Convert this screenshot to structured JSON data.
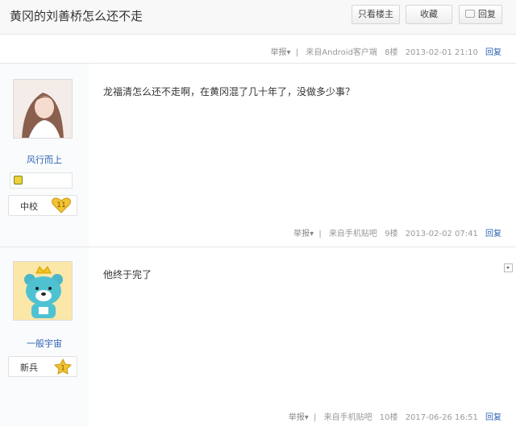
{
  "header": {
    "title": "黄冈的刘善桥怎么还不走",
    "btn_louzhu": "只看楼主",
    "btn_collect": "收藏",
    "btn_reply": "回复"
  },
  "top_tail": {
    "report": "举报",
    "source": "来自Android客户端",
    "floor": "8楼",
    "time": "2013-02-01 21:10",
    "reply": "回复"
  },
  "posts": [
    {
      "username": "风行而上",
      "rank_name": "中校",
      "level": "11",
      "content": "龙福清怎么还不走啊，在黄冈混了几十年了，没做多少事？",
      "tail": {
        "report": "举报",
        "source": "来自手机贴吧",
        "floor": "9楼",
        "time": "2013-02-02 07:41",
        "reply": "回复"
      }
    },
    {
      "username": "一般宇宙",
      "rank_name": "新兵",
      "level": "1",
      "content": "他终于完了",
      "tail": {
        "report": "举报",
        "source": "来自手机贴吧",
        "floor": "10楼",
        "time": "2017-06-26 16:51",
        "reply": "回复"
      }
    }
  ],
  "colors": {
    "link": "#2d64b3",
    "gold": "#f1c232"
  },
  "icons": [
    "reply-icon",
    "dropdown-caret-icon",
    "level-heart-icon",
    "badge-icon",
    "collapse-icon"
  ]
}
